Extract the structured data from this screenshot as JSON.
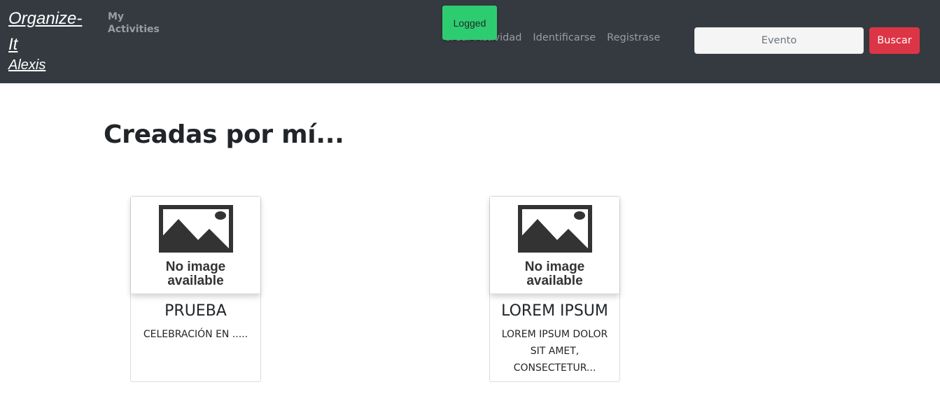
{
  "navbar": {
    "brand": "Organize-It",
    "user": "Alexis",
    "my_activities": "My Activities",
    "links": [
      "Crear Actividad",
      "Identificarse",
      "Registrase"
    ],
    "toast": "Logged",
    "search": {
      "placeholder": "Evento",
      "button": "Buscar"
    }
  },
  "main": {
    "title": "Creadas por mí...",
    "cards": [
      {
        "image_text": [
          "No image",
          "available"
        ],
        "title": "PRUEBA",
        "text": "CELEBRACIÓN EN ....."
      },
      {
        "image_text": [
          "No image",
          "available"
        ],
        "title": "LOREM IPSUM",
        "text": "LOREM IPSUM DOLOR SIT AMET, CONSECTETUR..."
      }
    ]
  },
  "colors": {
    "navbar_bg": "#343a40",
    "search_button": "#dc3545",
    "toast_bg": "#2ecc71"
  },
  "icons": [
    "no-image-placeholder-icon"
  ]
}
